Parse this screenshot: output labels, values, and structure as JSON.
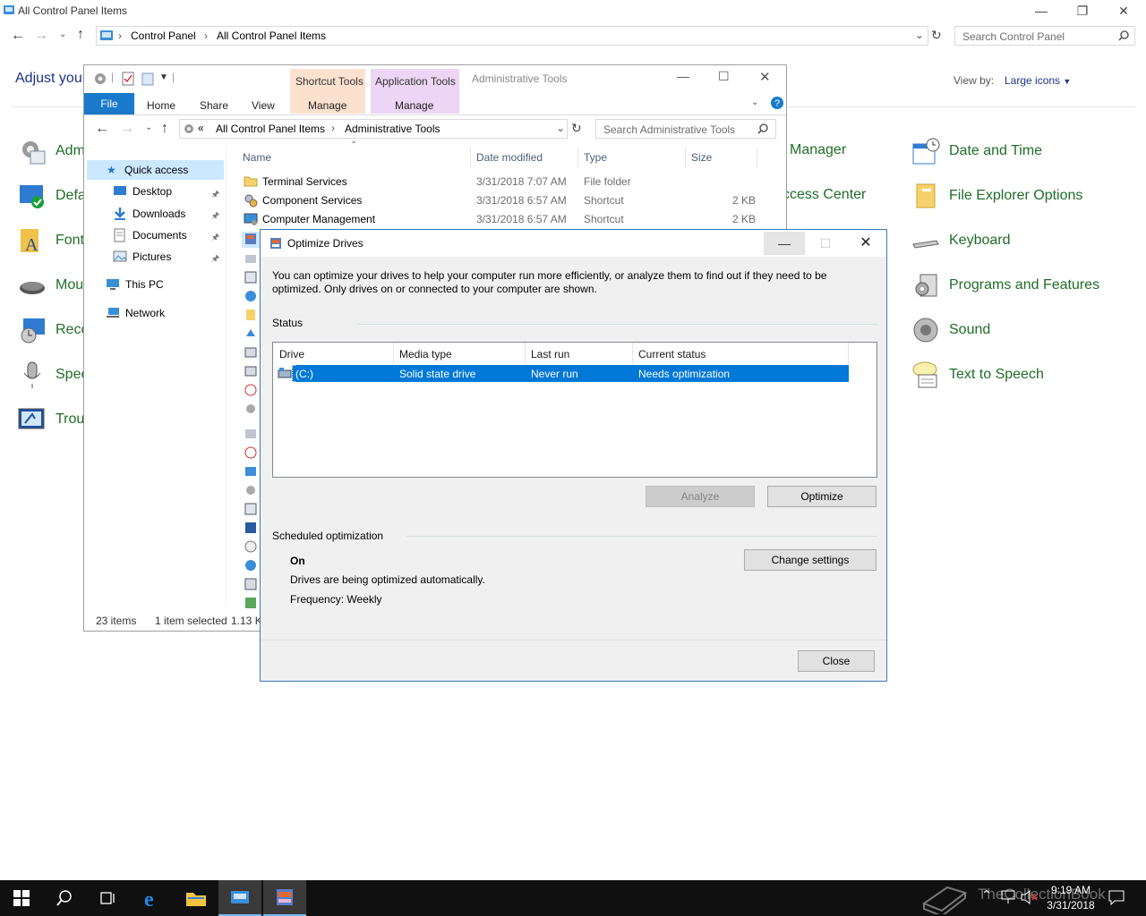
{
  "control_panel": {
    "window_title": "All Control Panel Items",
    "breadcrumb": [
      "Control Panel",
      "All Control Panel Items"
    ],
    "search_placeholder": "Search Control Panel",
    "heading": "Adjust your",
    "view_by_label": "View by:",
    "view_by_value": "Large icons",
    "items_left": [
      "Adm",
      "Defa",
      "Font",
      "Mou",
      "Reco",
      "Spee",
      "Trou"
    ],
    "items_mid": [
      "l Manager",
      "ccess Center"
    ],
    "items_right": [
      "Date and Time",
      "File Explorer Options",
      "Keyboard",
      "Programs and Features",
      "Sound",
      "Text to Speech"
    ]
  },
  "explorer": {
    "window_title": "Administrative Tools",
    "context_tabs": [
      "Shortcut Tools",
      "Application Tools"
    ],
    "context_sub": [
      "Manage",
      "Manage"
    ],
    "ribbon_tabs": [
      "File",
      "Home",
      "Share",
      "View"
    ],
    "breadcrumb": [
      "«",
      "All Control Panel Items",
      "Administrative Tools"
    ],
    "search_placeholder": "Search Administrative Tools",
    "nav": {
      "quick_access": "Quick access",
      "items": [
        "Desktop",
        "Downloads",
        "Documents",
        "Pictures"
      ],
      "this_pc": "This PC",
      "network": "Network"
    },
    "columns": [
      "Name",
      "Date modified",
      "Type",
      "Size"
    ],
    "rows": [
      {
        "name": "Terminal Services",
        "date": "3/31/2018 7:07 AM",
        "type": "File folder",
        "size": ""
      },
      {
        "name": "Component Services",
        "date": "3/31/2018 6:57 AM",
        "type": "Shortcut",
        "size": "2 KB"
      },
      {
        "name": "Computer Management",
        "date": "3/31/2018 6:57 AM",
        "type": "Shortcut",
        "size": "2 KB"
      }
    ],
    "status": {
      "count": "23 items",
      "selected": "1 item selected",
      "size": "1.13 K"
    }
  },
  "dialog": {
    "title": "Optimize Drives",
    "description": "You can optimize your drives to help your computer run more efficiently, or analyze them to find out if they need to be optimized. Only drives on or connected to your computer are shown.",
    "status_label": "Status",
    "columns": [
      "Drive",
      "Media type",
      "Last run",
      "Current status"
    ],
    "drives": [
      {
        "drive": "(C:)",
        "media": "Solid state drive",
        "last_run": "Never run",
        "status": "Needs optimization"
      }
    ],
    "analyze_label": "Analyze",
    "optimize_label": "Optimize",
    "scheduled_label": "Scheduled optimization",
    "schedule_state": "On",
    "schedule_desc": "Drives are being optimized automatically.",
    "frequency": "Frequency: Weekly",
    "change_settings_label": "Change settings",
    "close_label": "Close"
  },
  "taskbar": {
    "time": "9:19 AM",
    "date": "3/31/2018",
    "watermark": "TheCollectionBook"
  },
  "colors": {
    "accent": "#0078d7",
    "link_green": "#1e6e27",
    "selection": "#0078d7"
  }
}
